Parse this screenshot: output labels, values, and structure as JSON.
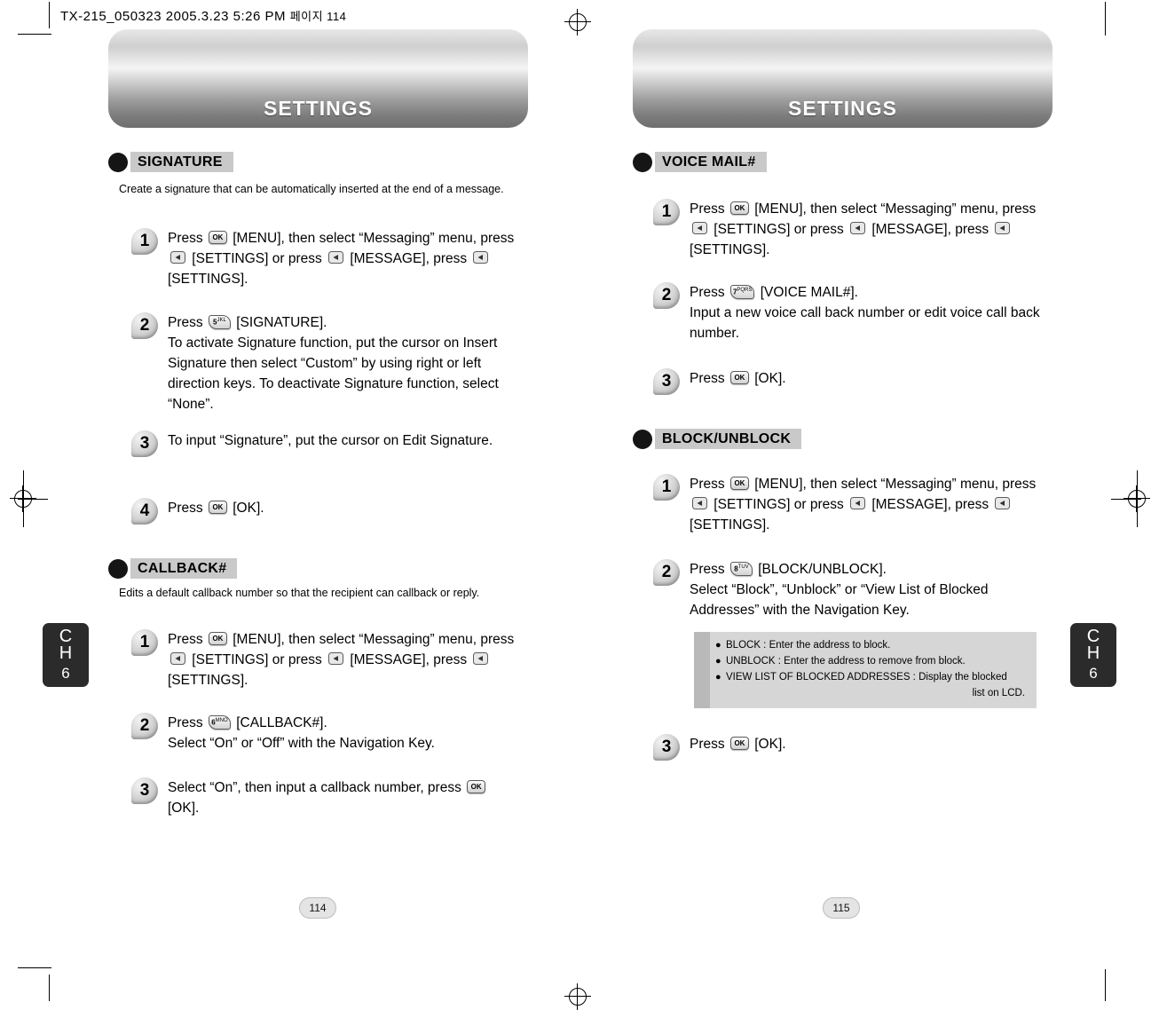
{
  "print_marks": {
    "header_code": "TX-215_050323  2005.3.23 5:26 PM",
    "header_code_kr": "페이지 114"
  },
  "pages": [
    {
      "banner_title": "SETTINGS",
      "page_number": "114",
      "chapter_tab": {
        "line1": "C",
        "line2": "H",
        "number": "6"
      },
      "sections": [
        {
          "heading": "SIGNATURE",
          "description": "Create a signature that can be automatically inserted at the end of a message.",
          "steps": [
            {
              "number": "1",
              "parts": [
                {
                  "t": "text",
                  "v": "Press "
                },
                {
                  "t": "key",
                  "v": "OK"
                },
                {
                  "t": "text",
                  "v": " [MENU], then select “Messaging” menu, press "
                },
                {
                  "t": "tri",
                  "v": "left-arrow-key"
                },
                {
                  "t": "text",
                  "v": " [SETTINGS] or press "
                },
                {
                  "t": "tri",
                  "v": "left-arrow-key"
                },
                {
                  "t": "text",
                  "v": " [MESSAGE], press "
                },
                {
                  "t": "tri",
                  "v": "left-arrow-key"
                },
                {
                  "t": "text",
                  "v": " [SETTINGS]."
                }
              ]
            },
            {
              "number": "2",
              "parts": [
                {
                  "t": "text",
                  "v": "Press "
                },
                {
                  "t": "numkey",
                  "v": "5",
                  "sup": "JKL"
                },
                {
                  "t": "text",
                  "v": " [SIGNATURE]."
                },
                {
                  "t": "br"
                },
                {
                  "t": "text",
                  "v": "To activate Signature function, put the cursor on Insert Signature then select “Custom” by using right or left direction keys. To deactivate Signature function, select “None”."
                }
              ]
            },
            {
              "number": "3",
              "parts": [
                {
                  "t": "text",
                  "v": "To input “Signature”, put the cursor on Edit Signature."
                }
              ]
            },
            {
              "number": "4",
              "parts": [
                {
                  "t": "text",
                  "v": "Press "
                },
                {
                  "t": "key",
                  "v": "OK"
                },
                {
                  "t": "text",
                  "v": " [OK]."
                }
              ]
            }
          ]
        },
        {
          "heading": "CALLBACK#",
          "description": "Edits a default callback number so that the recipient can callback or reply.",
          "steps": [
            {
              "number": "1",
              "parts": [
                {
                  "t": "text",
                  "v": "Press "
                },
                {
                  "t": "key",
                  "v": "OK"
                },
                {
                  "t": "text",
                  "v": " [MENU], then select “Messaging” menu, press "
                },
                {
                  "t": "tri",
                  "v": "left-arrow-key"
                },
                {
                  "t": "text",
                  "v": " [SETTINGS] or press "
                },
                {
                  "t": "tri",
                  "v": "left-arrow-key"
                },
                {
                  "t": "text",
                  "v": " [MESSAGE], press "
                },
                {
                  "t": "tri",
                  "v": "left-arrow-key"
                },
                {
                  "t": "text",
                  "v": " [SETTINGS]."
                }
              ]
            },
            {
              "number": "2",
              "parts": [
                {
                  "t": "text",
                  "v": "Press "
                },
                {
                  "t": "numkey",
                  "v": "6",
                  "sup": "MNO"
                },
                {
                  "t": "text",
                  "v": " [CALLBACK#]."
                },
                {
                  "t": "br"
                },
                {
                  "t": "text",
                  "v": "Select “On” or “Off” with the Navigation Key."
                }
              ]
            },
            {
              "number": "3",
              "parts": [
                {
                  "t": "text",
                  "v": "Select “On”, then input a callback number, press "
                },
                {
                  "t": "key",
                  "v": "OK"
                },
                {
                  "t": "text",
                  "v": " [OK]."
                }
              ]
            }
          ]
        }
      ]
    },
    {
      "banner_title": "SETTINGS",
      "page_number": "115",
      "chapter_tab": {
        "line1": "C",
        "line2": "H",
        "number": "6"
      },
      "sections": [
        {
          "heading": "VOICE MAIL#",
          "description": "",
          "steps": [
            {
              "number": "1",
              "parts": [
                {
                  "t": "text",
                  "v": "Press "
                },
                {
                  "t": "key",
                  "v": "OK"
                },
                {
                  "t": "text",
                  "v": " [MENU], then select “Messaging” menu, press "
                },
                {
                  "t": "tri",
                  "v": "left-arrow-key"
                },
                {
                  "t": "text",
                  "v": " [SETTINGS] or press "
                },
                {
                  "t": "tri",
                  "v": "left-arrow-key"
                },
                {
                  "t": "text",
                  "v": " [MESSAGE], press "
                },
                {
                  "t": "tri",
                  "v": "left-arrow-key"
                },
                {
                  "t": "text",
                  "v": " [SETTINGS]."
                }
              ]
            },
            {
              "number": "2",
              "parts": [
                {
                  "t": "text",
                  "v": "Press "
                },
                {
                  "t": "numkey",
                  "v": "7",
                  "sup": "PQRS"
                },
                {
                  "t": "text",
                  "v": " [VOICE MAIL#]."
                },
                {
                  "t": "br"
                },
                {
                  "t": "text",
                  "v": "Input a new voice call back number or edit voice call back number."
                }
              ]
            },
            {
              "number": "3",
              "parts": [
                {
                  "t": "text",
                  "v": "Press "
                },
                {
                  "t": "key",
                  "v": "OK"
                },
                {
                  "t": "text",
                  "v": " [OK]."
                }
              ]
            }
          ]
        },
        {
          "heading": "BLOCK/UNBLOCK",
          "description": "",
          "steps": [
            {
              "number": "1",
              "parts": [
                {
                  "t": "text",
                  "v": "Press "
                },
                {
                  "t": "key",
                  "v": "OK"
                },
                {
                  "t": "text",
                  "v": " [MENU], then select “Messaging” menu, press "
                },
                {
                  "t": "tri",
                  "v": "left-arrow-key"
                },
                {
                  "t": "text",
                  "v": " [SETTINGS] or press "
                },
                {
                  "t": "tri",
                  "v": "left-arrow-key"
                },
                {
                  "t": "text",
                  "v": " [MESSAGE], press "
                },
                {
                  "t": "tri",
                  "v": "left-arrow-key"
                },
                {
                  "t": "text",
                  "v": " [SETTINGS]."
                }
              ]
            },
            {
              "number": "2",
              "parts": [
                {
                  "t": "text",
                  "v": "Press "
                },
                {
                  "t": "numkey",
                  "v": "8",
                  "sup": "TUV"
                },
                {
                  "t": "text",
                  "v": " [BLOCK/UNBLOCK]."
                },
                {
                  "t": "br"
                },
                {
                  "t": "text",
                  "v": "Select “Block”, “Unblock” or “View List of Blocked Addresses” with the Navigation Key."
                }
              ]
            },
            {
              "number": "3",
              "parts": [
                {
                  "t": "text",
                  "v": "Press "
                },
                {
                  "t": "key",
                  "v": "OK"
                },
                {
                  "t": "text",
                  "v": " [OK]."
                }
              ]
            }
          ]
        }
      ],
      "note_box": {
        "rows": [
          {
            "bullet": "●",
            "text": "BLOCK : Enter the address to block.",
            "cont": ""
          },
          {
            "bullet": "●",
            "text": "UNBLOCK : Enter the address to remove from block.",
            "cont": ""
          },
          {
            "bullet": "●",
            "text": "VIEW LIST OF BLOCKED ADDRESSES : Display the blocked",
            "cont": "list on LCD."
          }
        ]
      }
    }
  ]
}
